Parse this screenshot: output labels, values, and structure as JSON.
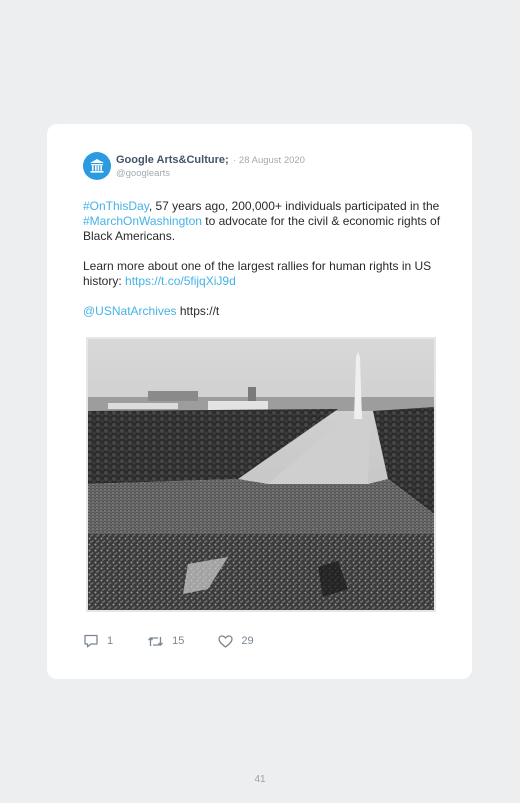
{
  "tweet": {
    "author_name": "Google Arts&Culture",
    "author_suffix": ";",
    "date": "· 28 August 2020",
    "handle": "@googlearts",
    "hashtag_onthisday": "#OnThisDay",
    "text_1": ", 57 years ago, 200,000+ individuals participated in the ",
    "hashtag_march": "#MarchOnWashington",
    "text_2": " to advocate for the civil & economic rights of Black Americans.",
    "text_3": "Learn more about one of the largest rallies for human rights in US history: ",
    "link": "https://t.co/5fijqXiJ9d",
    "mention": "@USNatArchives",
    "trailing_link": " https://t",
    "photo": "Black and white aerial photo of the crowd at the March on Washington along the Reflecting Pool with the Washington Monument"
  },
  "actions": {
    "replies": "1",
    "retweets": "15",
    "likes": "29"
  },
  "page_number": "41",
  "colors": {
    "accent": "#2a9be0",
    "link": "#45b3e6",
    "background": "#eceef0"
  }
}
